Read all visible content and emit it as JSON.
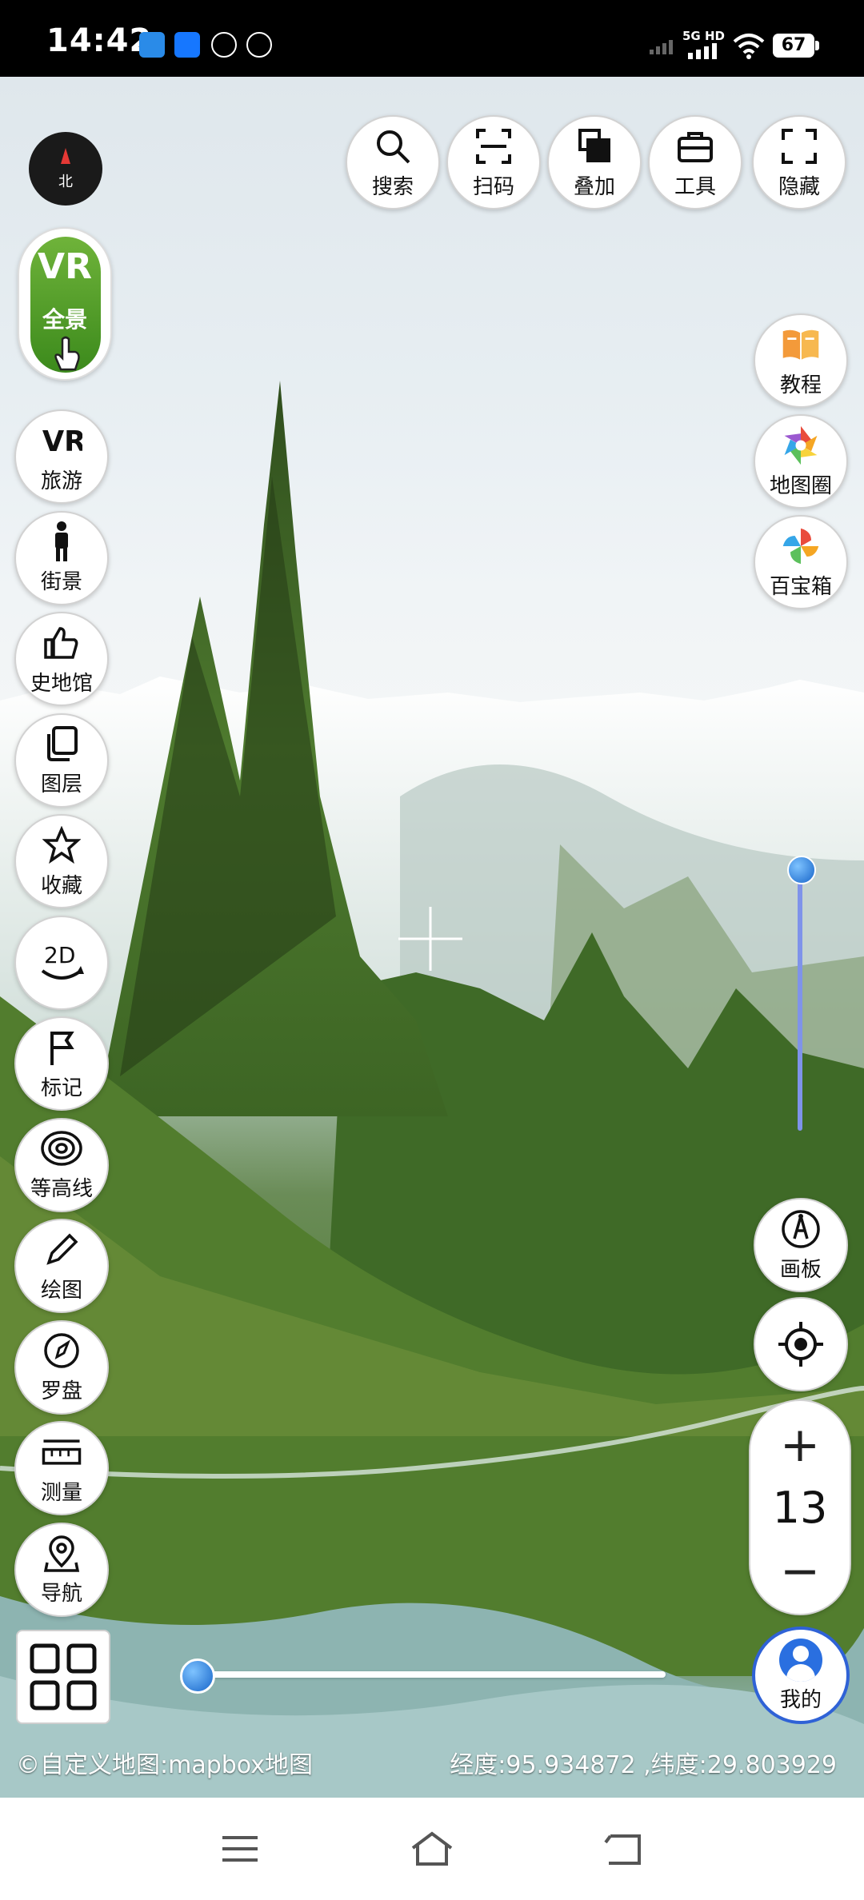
{
  "status_bar": {
    "time": "14:42",
    "network_label": "5G HD",
    "battery": "67",
    "app_icons": [
      "weibo-icon",
      "alipay-icon",
      "gesture-icon",
      "app-icon"
    ]
  },
  "top_toolbar": [
    {
      "id": "search",
      "label": "搜索",
      "icon": "search-icon"
    },
    {
      "id": "scan",
      "label": "扫码",
      "icon": "scan-icon"
    },
    {
      "id": "overlay",
      "label": "叠加",
      "icon": "overlay-icon"
    },
    {
      "id": "tools",
      "label": "工具",
      "icon": "toolbox-icon"
    },
    {
      "id": "hide",
      "label": "隐藏",
      "icon": "fullscreen-icon"
    }
  ],
  "compass": {
    "label": "北"
  },
  "vr_panorama": {
    "top": "VR",
    "bottom": "全景"
  },
  "left_menu": [
    {
      "id": "tour",
      "label": "旅游",
      "icon": "vr-icon"
    },
    {
      "id": "streetview",
      "label": "街景",
      "icon": "person-icon"
    },
    {
      "id": "history",
      "label": "史地馆",
      "icon": "thumbs-up-icon"
    },
    {
      "id": "layers",
      "label": "图层",
      "icon": "layers-icon"
    },
    {
      "id": "favorites",
      "label": "收藏",
      "icon": "star-icon"
    },
    {
      "id": "mode-2d",
      "label": "2D",
      "icon": "rotate-icon"
    },
    {
      "id": "mark",
      "label": "标记",
      "icon": "flag-icon"
    },
    {
      "id": "contour",
      "label": "等高线",
      "icon": "contour-icon"
    },
    {
      "id": "draw",
      "label": "绘图",
      "icon": "pencil-icon"
    },
    {
      "id": "compass",
      "label": "罗盘",
      "icon": "compass-icon"
    },
    {
      "id": "measure",
      "label": "测量",
      "icon": "ruler-icon"
    },
    {
      "id": "navigate",
      "label": "导航",
      "icon": "navigation-pin-icon"
    }
  ],
  "right_menu": [
    {
      "id": "tutorial",
      "label": "教程",
      "icon": "book-icon"
    },
    {
      "id": "map-circle",
      "label": "地图圈",
      "icon": "aperture-icon"
    },
    {
      "id": "toolbox",
      "label": "百宝箱",
      "icon": "pinwheel-icon"
    }
  ],
  "drawing_board": {
    "label": "画板",
    "icon": "compass-drawing-icon"
  },
  "locate": {
    "icon": "locate-icon"
  },
  "zoom": {
    "plus": "+",
    "level": "13",
    "minus": "−"
  },
  "mine": {
    "label": "我的",
    "icon": "user-icon"
  },
  "tilt_slider": {
    "value": 0.0
  },
  "rotation_slider": {
    "value": 0.0
  },
  "attribution": "©自定义地图:mapbox地图",
  "coordinates": "经度:95.934872 ,纬度:29.803929",
  "colors": {
    "accent_blue": "#2f62d6",
    "slider_blue": "#7f93ea",
    "vr_green": "#4f9a26"
  }
}
